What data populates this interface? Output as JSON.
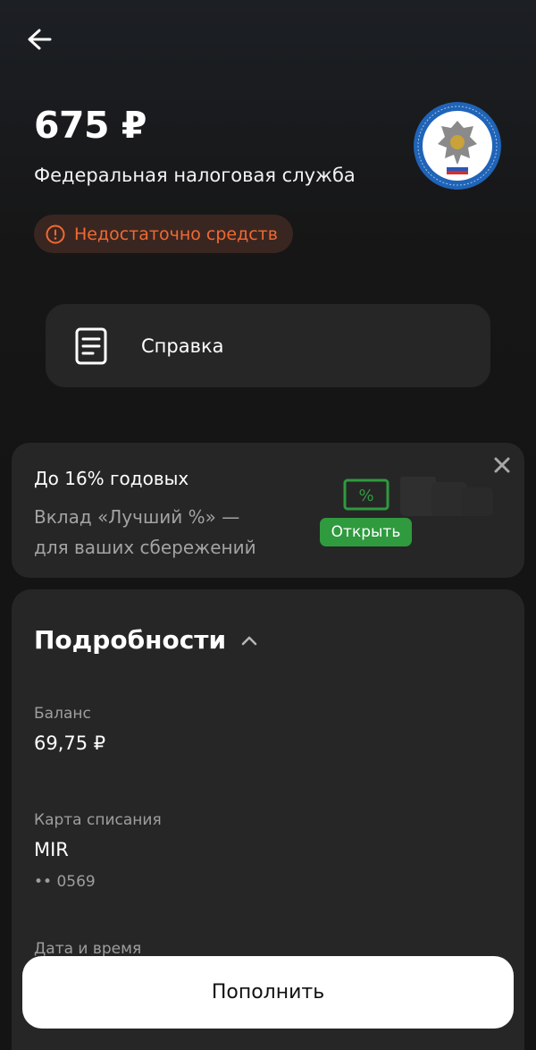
{
  "payment": {
    "amount": "675 ₽",
    "payee": "Федеральная налоговая служба",
    "status": "Недостаточно средств",
    "logo_icon": "fns-emblem-icon"
  },
  "reference": {
    "label": "Справка",
    "icon": "document-icon"
  },
  "promo": {
    "title": "До 16% годовых",
    "subtitle_line1": "Вклад «Лучший %» —",
    "subtitle_line2": "для ваших сбережений",
    "button": "Открыть"
  },
  "details": {
    "heading": "Подробности",
    "balance": {
      "label": "Баланс",
      "value": "69,75 ₽"
    },
    "card": {
      "label": "Карта списания",
      "value": "MIR",
      "number": "•• 0569"
    },
    "datetime": {
      "label": "Дата и время"
    }
  },
  "cta": {
    "label": "Пополнить"
  },
  "colors": {
    "background": "#141414",
    "card": "#262626",
    "warning": "#f06a33",
    "accent_green": "#2f9a3e"
  }
}
